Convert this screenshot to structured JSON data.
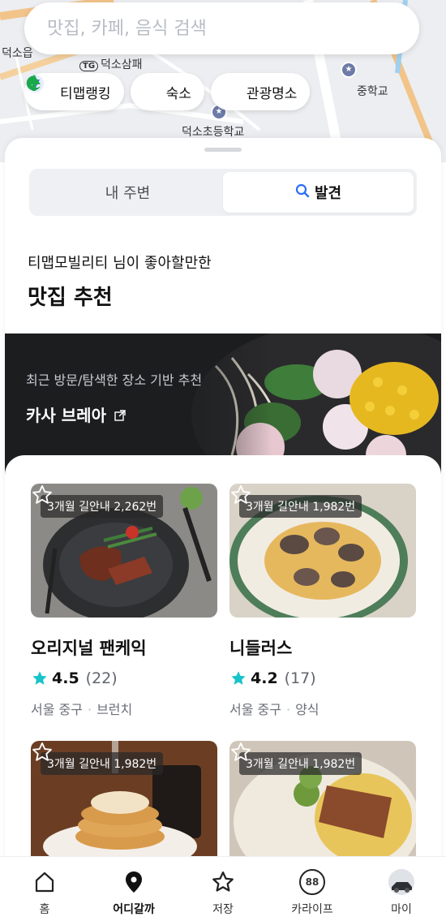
{
  "search": {
    "placeholder": "맛집, 카페, 음식 검색"
  },
  "map": {
    "labels": {
      "left": "덕소읍",
      "tg_badge": "TG",
      "tg_label": "덕소삼패",
      "right": "중학교",
      "bottom": "덕소초등학교"
    }
  },
  "chips": [
    {
      "label": "티맵랭킹",
      "icon": "ranking-badge-icon"
    },
    {
      "label": "숙소",
      "icon": "moon-icon"
    },
    {
      "label": "관광명소",
      "icon": "tree-icon"
    }
  ],
  "tabs": {
    "nearby": "내 주변",
    "discover": "발견"
  },
  "recommend": {
    "subtitle": "티맵모빌리티 님이 좋아할만한",
    "title": "맛집 추천"
  },
  "banner": {
    "sub": "최근 방문/탐색한 장소 기반 추천",
    "title": "카사 브레아",
    "ext_icon": "external-link-icon"
  },
  "cards": [
    {
      "badge": "3개월 길안내 2,262번",
      "name": "오리지널 팬케익",
      "rating": "4.5",
      "count": "(22)",
      "region": "서울 중구",
      "category": "브런치"
    },
    {
      "badge": "3개월 길안내 1,982번",
      "name": "니들러스",
      "rating": "4.2",
      "count": "(17)",
      "region": "서울 중구",
      "category": "양식"
    },
    {
      "badge": "3개월 길안내 1,982번"
    },
    {
      "badge": "3개월 길안내 1,982번"
    }
  ],
  "nav": [
    {
      "label": "홈",
      "icon": "home-icon"
    },
    {
      "label": "어디갈까",
      "icon": "location-pin-icon"
    },
    {
      "label": "저장",
      "icon": "star-icon"
    },
    {
      "label": "카라이프",
      "icon": "car-life-icon",
      "badge": "88"
    },
    {
      "label": "마이",
      "icon": "avatar"
    }
  ],
  "colors": {
    "accent": "#2b6ef5",
    "star": "#18c3c9",
    "nav_active": "#111111"
  }
}
